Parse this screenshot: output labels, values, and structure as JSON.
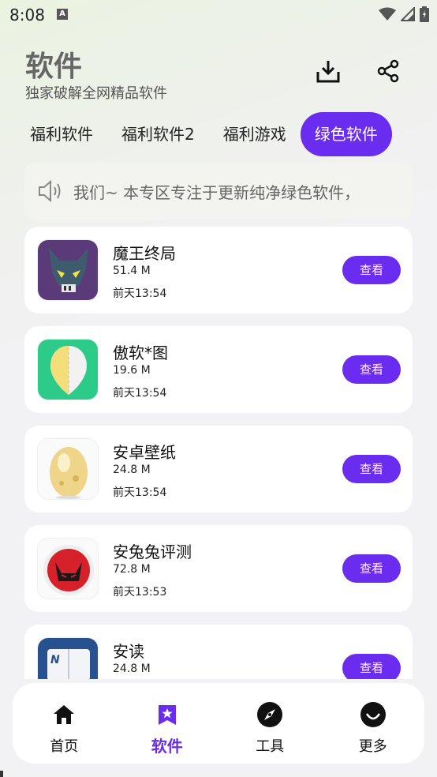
{
  "status": {
    "time": "8:08",
    "app_indicator": "A"
  },
  "header": {
    "title": "软件",
    "subtitle": "独家破解全网精品软件",
    "download_icon": "download-tray-icon",
    "share_icon": "share-icon"
  },
  "tabs": [
    {
      "label": "福利软件",
      "active": false
    },
    {
      "label": "福利软件2",
      "active": false
    },
    {
      "label": "福利游戏",
      "active": false
    },
    {
      "label": "绿色软件",
      "active": true
    }
  ],
  "notice": {
    "icon": "speaker-icon",
    "text": "我们~   本专区专注于更新纯净绿色软件，"
  },
  "apps": [
    {
      "name": "魔王终局",
      "size": "51.4 M",
      "date": "前天13:54",
      "button": "查看",
      "icon": "demon-pixel-icon"
    },
    {
      "name": "傲软*图",
      "size": "19.6 M",
      "date": "前天13:54",
      "button": "查看",
      "icon": "photo-cutout-icon"
    },
    {
      "name": "安卓壁纸",
      "size": "24.8 M",
      "date": "前天13:54",
      "button": "查看",
      "icon": "golden-egg-icon"
    },
    {
      "name": "安兔兔评测",
      "size": "72.8 M",
      "date": "前天13:53",
      "button": "查看",
      "icon": "antutu-icon"
    },
    {
      "name": "安读",
      "size": "24.8 M",
      "date": "",
      "button": "查看",
      "icon": "book-reader-icon"
    }
  ],
  "bottom_nav": [
    {
      "label": "首页",
      "icon": "home-icon",
      "active": false
    },
    {
      "label": "软件",
      "icon": "star-bookmark-icon",
      "active": true
    },
    {
      "label": "工具",
      "icon": "compass-icon",
      "active": false
    },
    {
      "label": "更多",
      "icon": "smile-icon",
      "active": false
    }
  ],
  "colors": {
    "accent": "#6a2cef",
    "card": "#ffffff",
    "notice_bg": "#f3f4f0"
  }
}
